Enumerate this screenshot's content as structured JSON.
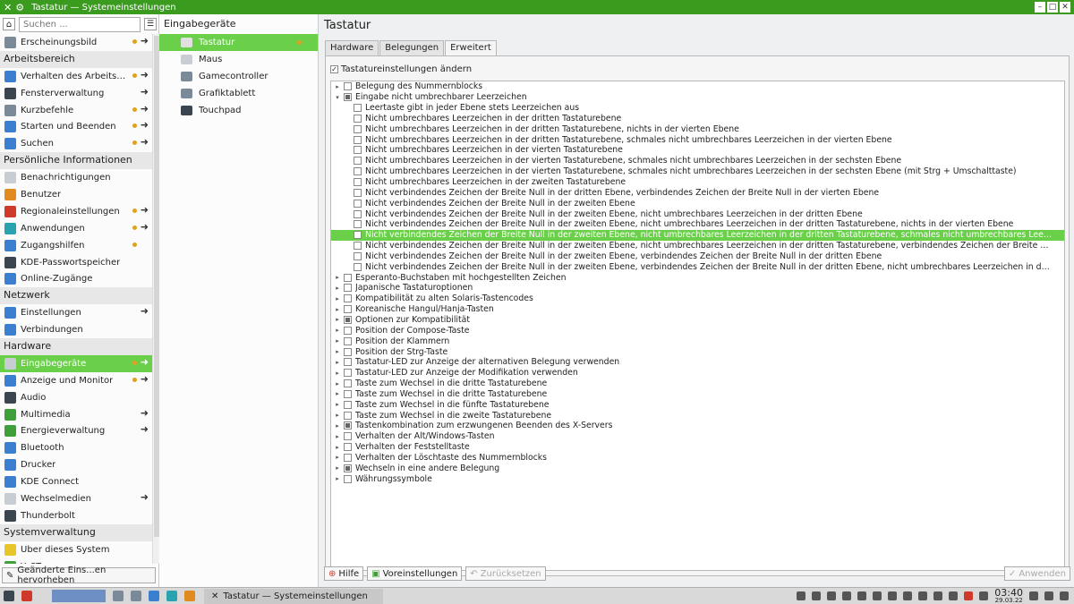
{
  "window": {
    "title": "Tastatur — Systemeinstellungen"
  },
  "sidebar": {
    "search_placeholder": "Suchen ...",
    "entries": [
      {
        "type": "item",
        "label": "Erscheinungsbild",
        "icon": "appearance-icon",
        "color": "#7b8a99",
        "dot": true,
        "arrow": true
      },
      {
        "type": "cat",
        "label": "Arbeitsbereich"
      },
      {
        "type": "item",
        "label": "Verhalten des Arbeitsb...",
        "icon": "workspace-icon",
        "color": "#3a7fd0",
        "dot": true,
        "arrow": true
      },
      {
        "type": "item",
        "label": "Fensterverwaltung",
        "icon": "window-icon",
        "color": "#3b4550",
        "dot": false,
        "arrow": true
      },
      {
        "type": "item",
        "label": "Kurzbefehle",
        "icon": "shortcuts-icon",
        "color": "#7b8a99",
        "dot": true,
        "arrow": true
      },
      {
        "type": "item",
        "label": "Starten und Beenden",
        "icon": "startup-icon",
        "color": "#3a7fd0",
        "dot": true,
        "arrow": true
      },
      {
        "type": "item",
        "label": "Suchen",
        "icon": "search-icon",
        "color": "#3a7fd0",
        "dot": true,
        "arrow": true
      },
      {
        "type": "cat",
        "label": "Persönliche Informationen"
      },
      {
        "type": "item",
        "label": "Benachrichtigungen",
        "icon": "notifications-icon",
        "color": "#c7cdd2",
        "dot": false,
        "arrow": false
      },
      {
        "type": "item",
        "label": "Benutzer",
        "icon": "users-icon",
        "color": "#e08a1f",
        "dot": false,
        "arrow": false
      },
      {
        "type": "item",
        "label": "Regionaleinstellungen",
        "icon": "flag-icon",
        "color": "#d03a2a",
        "dot": true,
        "arrow": true
      },
      {
        "type": "item",
        "label": "Anwendungen",
        "icon": "applications-icon",
        "color": "#29a3b0",
        "dot": true,
        "arrow": true
      },
      {
        "type": "item",
        "label": "Zugangshilfen",
        "icon": "accessibility-icon",
        "color": "#3a7fd0",
        "dot": true,
        "arrow": false
      },
      {
        "type": "item",
        "label": "KDE-Passwortspeicher",
        "icon": "wallet-icon",
        "color": "#3b4550",
        "dot": false,
        "arrow": false
      },
      {
        "type": "item",
        "label": "Online-Zugänge",
        "icon": "online-accounts-icon",
        "color": "#3a7fd0",
        "dot": false,
        "arrow": false
      },
      {
        "type": "cat",
        "label": "Netzwerk"
      },
      {
        "type": "item",
        "label": "Einstellungen",
        "icon": "network-settings-icon",
        "color": "#3a7fd0",
        "dot": false,
        "arrow": true
      },
      {
        "type": "item",
        "label": "Verbindungen",
        "icon": "connections-icon",
        "color": "#3a7fd0",
        "dot": false,
        "arrow": false
      },
      {
        "type": "cat",
        "label": "Hardware"
      },
      {
        "type": "item",
        "label": "Eingabegeräte",
        "icon": "mouse-icon",
        "color": "#c7cdd2",
        "dot": true,
        "arrow": true,
        "selected": true
      },
      {
        "type": "item",
        "label": "Anzeige und Monitor",
        "icon": "display-icon",
        "color": "#3a7fd0",
        "dot": true,
        "arrow": true
      },
      {
        "type": "item",
        "label": "Audio",
        "icon": "audio-icon",
        "color": "#3b4550",
        "dot": false,
        "arrow": false
      },
      {
        "type": "item",
        "label": "Multimedia",
        "icon": "multimedia-icon",
        "color": "#3fa03a",
        "dot": false,
        "arrow": true
      },
      {
        "type": "item",
        "label": "Energieverwaltung",
        "icon": "power-icon",
        "color": "#3fa03a",
        "dot": false,
        "arrow": true
      },
      {
        "type": "item",
        "label": "Bluetooth",
        "icon": "bluetooth-icon",
        "color": "#3a7fd0",
        "dot": false,
        "arrow": false
      },
      {
        "type": "item",
        "label": "Drucker",
        "icon": "printer-icon",
        "color": "#3a7fd0",
        "dot": false,
        "arrow": false
      },
      {
        "type": "item",
        "label": "KDE Connect",
        "icon": "kde-connect-icon",
        "color": "#3a7fd0",
        "dot": false,
        "arrow": false
      },
      {
        "type": "item",
        "label": "Wechselmedien",
        "icon": "removable-media-icon",
        "color": "#c7cdd2",
        "dot": false,
        "arrow": true
      },
      {
        "type": "item",
        "label": "Thunderbolt",
        "icon": "thunderbolt-icon",
        "color": "#3b4550",
        "dot": false,
        "arrow": false
      },
      {
        "type": "cat",
        "label": "Systemverwaltung"
      },
      {
        "type": "item",
        "label": "Über dieses System",
        "icon": "info-icon",
        "color": "#e8c52a",
        "dot": false,
        "arrow": false
      },
      {
        "type": "item",
        "label": "YaST",
        "icon": "yast-icon",
        "color": "#3fa03a",
        "dot": false,
        "arrow": false
      }
    ],
    "footer_label": "Geänderte Eins...en hervorheben"
  },
  "subnav": {
    "title": "Eingabegeräte",
    "items": [
      {
        "label": "Tastatur",
        "icon": "keyboard-icon",
        "color": "#e0e0e0",
        "selected": true,
        "dot": true
      },
      {
        "label": "Maus",
        "icon": "mouse-icon",
        "color": "#c7cdd2"
      },
      {
        "label": "Gamecontroller",
        "icon": "gamepad-icon",
        "color": "#7b8a99"
      },
      {
        "label": "Grafiktablett",
        "icon": "tablet-icon",
        "color": "#7b8a99"
      },
      {
        "label": "Touchpad",
        "icon": "touchpad-icon",
        "color": "#3b4550"
      }
    ]
  },
  "main": {
    "title": "Tastatur",
    "tabs": [
      "Hardware",
      "Belegungen",
      "Erweitert"
    ],
    "active_tab": 2,
    "change_settings_label": "Tastatureinstellungen ändern",
    "tree": [
      {
        "level": 0,
        "exp": "▸",
        "state": "none",
        "text": "Belegung des Nummernblocks"
      },
      {
        "level": 0,
        "exp": "▾",
        "state": "partial",
        "text": "Eingabe nicht umbrechbarer Leerzeichen"
      },
      {
        "level": 1,
        "state": "none",
        "text": "Leertaste gibt in jeder Ebene stets Leerzeichen aus"
      },
      {
        "level": 1,
        "state": "none",
        "text": "Nicht umbrechbares Leerzeichen in der dritten Tastaturebene"
      },
      {
        "level": 1,
        "state": "none",
        "text": "Nicht umbrechbares Leerzeichen in der dritten Tastaturebene, nichts in der vierten Ebene"
      },
      {
        "level": 1,
        "state": "none",
        "text": "Nicht umbrechbares Leerzeichen in der dritten Tastaturebene, schmales nicht umbrechbares Leerzeichen in der vierten Ebene"
      },
      {
        "level": 1,
        "state": "none",
        "text": "Nicht umbrechbares Leerzeichen in der vierten Tastaturebene"
      },
      {
        "level": 1,
        "state": "none",
        "text": "Nicht umbrechbares Leerzeichen in der vierten Tastaturebene, schmales nicht umbrechbares Leerzeichen in der sechsten Ebene"
      },
      {
        "level": 1,
        "state": "none",
        "text": "Nicht umbrechbares Leerzeichen in der vierten Tastaturebene, schmales nicht umbrechbares Leerzeichen in der sechsten Ebene (mit Strg + Umschalttaste)"
      },
      {
        "level": 1,
        "state": "none",
        "text": "Nicht umbrechbares Leerzeichen in der zweiten Tastaturebene"
      },
      {
        "level": 1,
        "state": "none",
        "text": "Nicht verbindendes Zeichen der Breite Null in der dritten Ebene, verbindendes Zeichen der Breite Null in der vierten Ebene"
      },
      {
        "level": 1,
        "state": "none",
        "text": "Nicht verbindendes Zeichen der Breite Null in der zweiten Ebene"
      },
      {
        "level": 1,
        "state": "none",
        "text": "Nicht verbindendes Zeichen der Breite Null in der zweiten Ebene, nicht umbrechbares Leerzeichen in der dritten Ebene"
      },
      {
        "level": 1,
        "state": "none",
        "text": "Nicht verbindendes Zeichen der Breite Null in der zweiten Ebene, nicht umbrechbares Leerzeichen in der dritten Tastaturebene, nichts in der vierten Ebene"
      },
      {
        "level": 1,
        "state": "checked",
        "selected": true,
        "text": "Nicht verbindendes Zeichen der Breite Null in der zweiten Ebene, nicht umbrechbares Leerzeichen in der dritten Tastaturebene, schmales nicht umbrechbares Leerzei..."
      },
      {
        "level": 1,
        "state": "none",
        "text": "Nicht verbindendes Zeichen der Breite Null in der zweiten Ebene, nicht umbrechbares Leerzeichen in der dritten Tastaturebene, verbindendes Zeichen der Breite Null i..."
      },
      {
        "level": 1,
        "state": "none",
        "text": "Nicht verbindendes Zeichen der Breite Null in der zweiten Ebene, verbindendes Zeichen der Breite Null in der dritten Ebene"
      },
      {
        "level": 1,
        "state": "none",
        "text": "Nicht verbindendes Zeichen der Breite Null in der zweiten Ebene, verbindendes Zeichen der Breite Null in der dritten Ebene, nicht umbrechbares Leerzeichen in der vie..."
      },
      {
        "level": 0,
        "exp": "▸",
        "state": "none",
        "text": "Esperanto-Buchstaben mit hochgestellten Zeichen"
      },
      {
        "level": 0,
        "exp": "▸",
        "state": "none",
        "text": "Japanische Tastaturoptionen"
      },
      {
        "level": 0,
        "exp": "▸",
        "state": "none",
        "text": "Kompatibilität zu alten Solaris-Tastencodes"
      },
      {
        "level": 0,
        "exp": "▸",
        "state": "none",
        "text": "Koreanische Hangul/Hanja-Tasten"
      },
      {
        "level": 0,
        "exp": "▸",
        "state": "partial",
        "text": "Optionen zur Kompatibilität"
      },
      {
        "level": 0,
        "exp": "▸",
        "state": "none",
        "text": "Position der Compose-Taste"
      },
      {
        "level": 0,
        "exp": "▸",
        "state": "none",
        "text": "Position der Klammern"
      },
      {
        "level": 0,
        "exp": "▸",
        "state": "none",
        "text": "Position der Strg-Taste"
      },
      {
        "level": 0,
        "exp": "▸",
        "state": "none",
        "text": "Tastatur-LED zur Anzeige der alternativen Belegung verwenden"
      },
      {
        "level": 0,
        "exp": "▸",
        "state": "none",
        "text": "Tastatur-LED zur Anzeige der Modifikation verwenden"
      },
      {
        "level": 0,
        "exp": "▸",
        "state": "none",
        "text": "Taste zum Wechsel in die dritte Tastaturebene"
      },
      {
        "level": 0,
        "exp": "▸",
        "state": "none",
        "text": "Taste zum Wechsel in die dritte Tastaturebene"
      },
      {
        "level": 0,
        "exp": "▸",
        "state": "none",
        "text": "Taste zum Wechsel in die fünfte Tastaturebene"
      },
      {
        "level": 0,
        "exp": "▸",
        "state": "none",
        "text": "Taste zum Wechsel in die zweite Tastaturebene"
      },
      {
        "level": 0,
        "exp": "▸",
        "state": "partial",
        "text": "Tastenkombination zum erzwungenen Beenden des X-Servers"
      },
      {
        "level": 0,
        "exp": "▸",
        "state": "none",
        "text": "Verhalten der Alt/Windows-Tasten"
      },
      {
        "level": 0,
        "exp": "▸",
        "state": "none",
        "text": "Verhalten der Feststelltaste"
      },
      {
        "level": 0,
        "exp": "▸",
        "state": "none",
        "text": "Verhalten der Löschtaste des Nummernblocks"
      },
      {
        "level": 0,
        "exp": "▸",
        "state": "partial",
        "text": "Wechseln in eine andere Belegung"
      },
      {
        "level": 0,
        "exp": "▸",
        "state": "none",
        "text": "Währungssymbole"
      }
    ],
    "buttons": {
      "help": "Hilfe",
      "defaults": "Voreinstellungen",
      "reset": "Zurücksetzen",
      "apply": "Anwenden"
    }
  },
  "taskbar": {
    "task_label": "Tastatur — Systemeinstellungen",
    "time": "03:40",
    "date": "29.03.22"
  },
  "colors": {
    "accent": "#6ad04a",
    "titlebar": "#3a9b1f"
  }
}
